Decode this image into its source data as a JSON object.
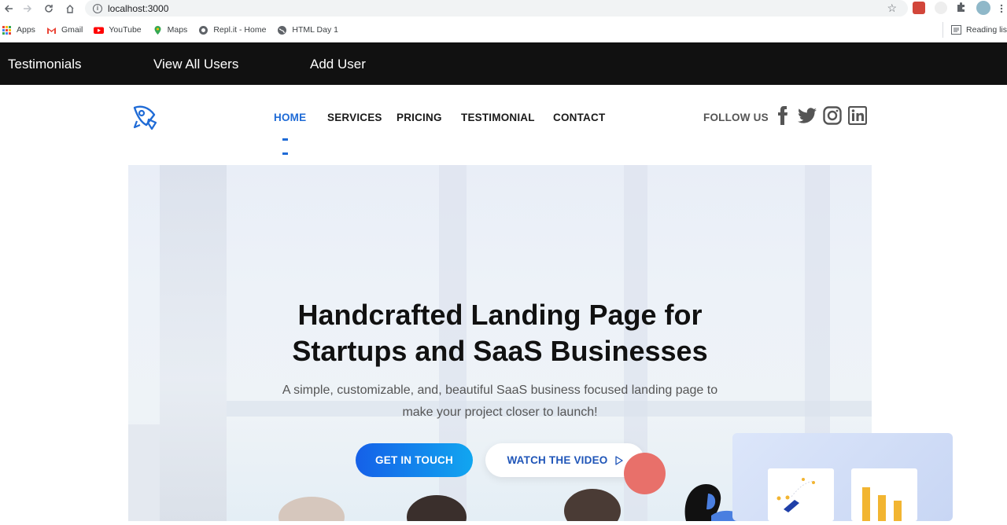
{
  "browser": {
    "url": "localhost:3000",
    "bookmarks": [
      {
        "label": "Apps"
      },
      {
        "label": "Gmail"
      },
      {
        "label": "YouTube"
      },
      {
        "label": "Maps"
      },
      {
        "label": "Repl.it - Home"
      },
      {
        "label": "HTML Day 1"
      }
    ],
    "reading_list": "Reading lis"
  },
  "app_nav": {
    "testimonials": "Testimonials",
    "view_all_users": "View All Users",
    "add_user": "Add User"
  },
  "site_header": {
    "menu": [
      {
        "label": "HOME",
        "active": true
      },
      {
        "label": "SERVICES",
        "active": false
      },
      {
        "label": "PRICING",
        "active": false
      },
      {
        "label": "TESTIMONIAL",
        "active": false
      },
      {
        "label": "CONTACT",
        "active": false
      }
    ],
    "follow_us": "FOLLOW US",
    "social": [
      "facebook-icon",
      "twitter-icon",
      "instagram-icon",
      "linkedin-icon"
    ],
    "accent": "#1f6bd6"
  },
  "hero": {
    "title_line1": "Handcrafted Landing Page for",
    "title_line2": "Startups and SaaS Businesses",
    "subtitle_line1": "A simple, customizable, and, beautiful SaaS business focused landing page to",
    "subtitle_line2": "make your project closer to launch!",
    "primary_button": "GET IN TOUCH",
    "secondary_button": "WATCH THE VIDEO"
  }
}
